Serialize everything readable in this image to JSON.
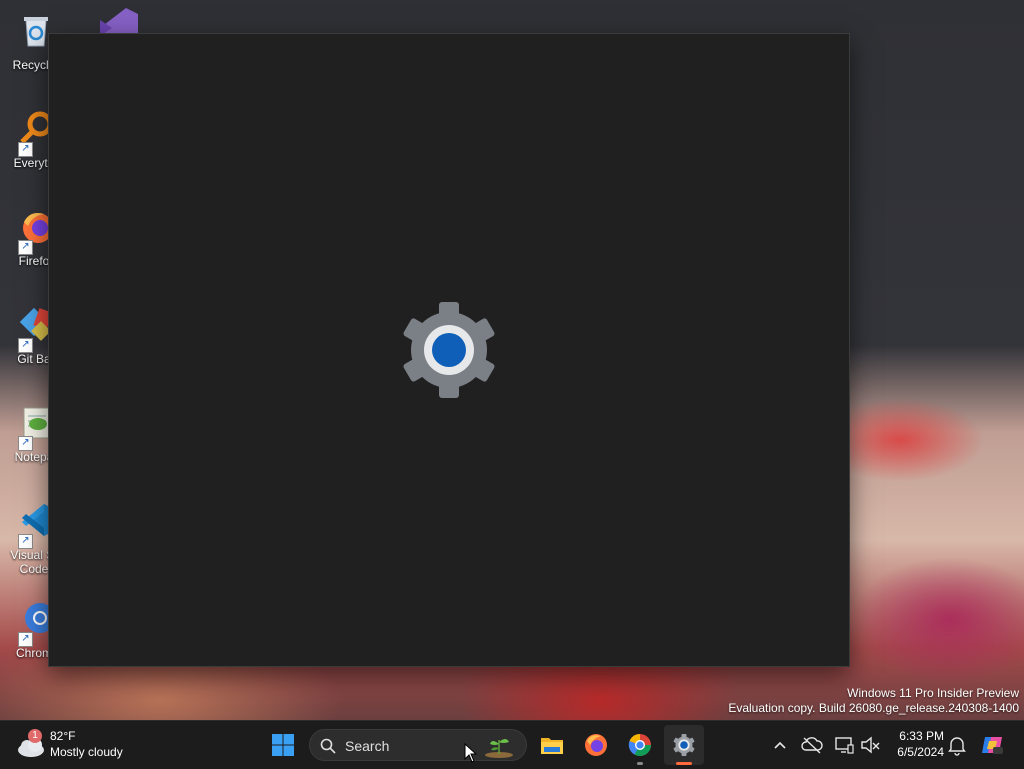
{
  "desktop": {
    "icons": [
      {
        "label": "Recycle",
        "icon": "recycle-bin-icon"
      },
      {
        "label": "Everyth",
        "icon": "everything-search-icon"
      },
      {
        "label": "Firefo",
        "icon": "firefox-icon"
      },
      {
        "label": "Git Ba",
        "icon": "git-bash-icon"
      },
      {
        "label": "Notepa",
        "icon": "notepad-plus-plus-icon"
      },
      {
        "label": "Visual St\nCode",
        "icon": "vscode-icon"
      },
      {
        "label": "Chrom",
        "icon": "chromium-icon"
      }
    ],
    "watermark": {
      "line1": "Windows 11 Pro Insider Preview",
      "line2": "Evaluation copy. Build 26080.ge_release.240308-1400"
    }
  },
  "window": {
    "app": "Settings",
    "state": "loading",
    "splash_icon": "settings-gear-icon",
    "background": "#202020"
  },
  "taskbar": {
    "weather": {
      "badge": "1",
      "temp": "82°F",
      "condition": "Mostly cloudy",
      "icon": "cloud-icon"
    },
    "search": {
      "placeholder": "Search"
    },
    "pinned": [
      {
        "name": "start-button",
        "icon": "windows-logo-icon"
      },
      {
        "name": "file-explorer",
        "icon": "folder-icon"
      },
      {
        "name": "firefox",
        "icon": "firefox-icon"
      },
      {
        "name": "chromium",
        "icon": "chromium-icon"
      },
      {
        "name": "settings",
        "icon": "settings-gear-icon",
        "active": true
      }
    ],
    "tray": {
      "icons": [
        "chevron-up-icon",
        "cloud-offline-icon",
        "network-icon",
        "volume-mute-icon",
        "notification-bell-icon",
        "copilot-icon"
      ],
      "time": "6:33 PM",
      "date": "6/5/2024"
    }
  },
  "colors": {
    "accent": "#0067c0",
    "taskbar": "#1c1c1c",
    "active_indicator": "#ff6a3d"
  }
}
